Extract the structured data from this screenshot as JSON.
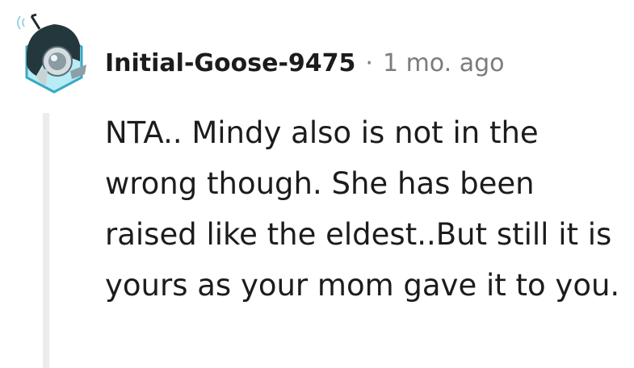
{
  "comment": {
    "username": "Initial-Goose-9475",
    "separator": "·",
    "timestamp": "1 mo. ago",
    "body": "NTA.. Mindy also is not in the wrong though. She has been raised like the eldest..But still it is yours as your mom gave it to you."
  },
  "colors": {
    "text": "#1c1c1c",
    "muted": "#7c7c7c",
    "thread_line": "#ececec"
  }
}
